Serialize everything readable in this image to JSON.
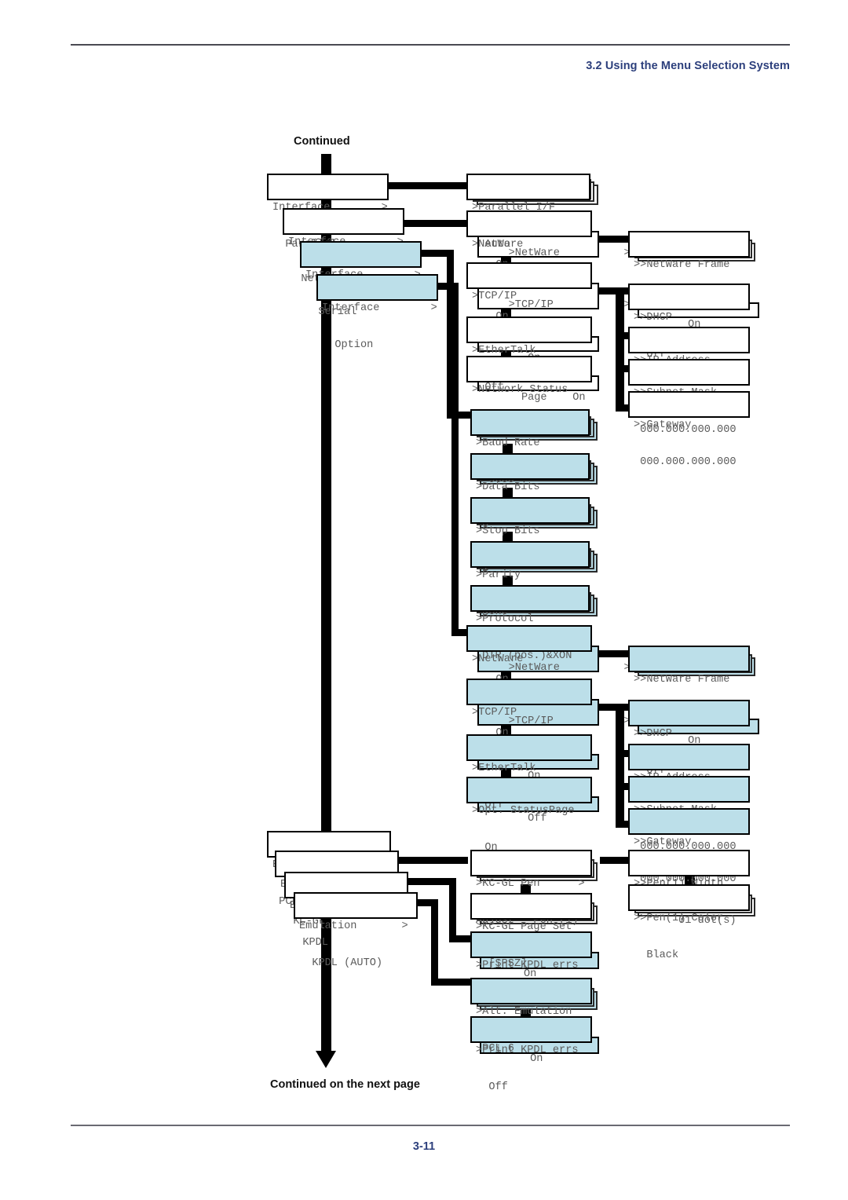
{
  "header": {
    "section_title": "3.2 Using the Menu Selection System"
  },
  "footer": {
    "page_number": "3-11"
  },
  "labels": {
    "continued_top": "Continued",
    "continued_bottom": "Continued on the next page"
  },
  "diagram": {
    "type": "printer-menu-tree",
    "spine_arrow": "down-arrow",
    "interface_column": [
      {
        "id": "iface-parallel",
        "line1": "Interface        >",
        "line2": "  Parallel",
        "highlight": false
      },
      {
        "id": "iface-network",
        "line1": "Interface        >",
        "line2": "  Network",
        "highlight": false
      },
      {
        "id": "iface-serial",
        "line1": "Interface        >",
        "line2": "  Serial",
        "highlight": true
      },
      {
        "id": "iface-option",
        "line1": "Interface        >",
        "line2": "  Option",
        "highlight": true
      }
    ],
    "emulation_column": [
      {
        "id": "emu-pcl6",
        "line1": "Emulation",
        "line2": " PCL 6",
        "highlight": false
      },
      {
        "id": "emu-kcgl",
        "line1": "Emulation       >",
        "line2": "  KC-GL",
        "highlight": false
      },
      {
        "id": "emu-kpdl",
        "line1": "Emulation       >",
        "line2": "  KPDL",
        "highlight": false
      },
      {
        "id": "emu-kpdl-auto",
        "line1": "Emulation       >",
        "line2": "  KPDL (AUTO)",
        "highlight": false
      }
    ],
    "parallel_branch": [
      {
        "id": "parallel-if",
        "line1": ">Parallel I/F",
        "line2": "  Auto",
        "highlight": false,
        "stacks": 3
      }
    ],
    "network_branch_1": [
      {
        "id": "net1-netware",
        "line1": ">NetWare",
        "line2": "  Off",
        "sub": ">NetWare          >\n  On",
        "highlight": false
      },
      {
        "id": "net1-tcpip",
        "line1": ">TCP/IP",
        "line2": "  Off",
        "sub": ">TCP/IP           >\n  On",
        "highlight": false
      },
      {
        "id": "net1-ethertalk",
        "line1": ">EtherTalk",
        "line2": "  Off",
        "sub": "   On",
        "highlight": false
      },
      {
        "id": "net1-netstatus",
        "line1": ">Network Status",
        "line2": " Page    Off",
        "sub": "  Page    On",
        "highlight": false
      }
    ],
    "network_branch_1_leaves": [
      {
        "id": "net1-netware-frame",
        "line1": ">>NetWare Frame",
        "line2": "  Auto",
        "highlight": false,
        "stacks": 3
      },
      {
        "id": "net1-dhcp",
        "line1": ">>DHCP",
        "line2": "  Off",
        "sub": "   On",
        "highlight": false
      },
      {
        "id": "net1-ip",
        "line1": ">>IP Address",
        "line2": " 000.000.000.000",
        "highlight": false
      },
      {
        "id": "net1-subnet",
        "line1": ">>Subnet Mask",
        "line2": " 000.000.000.000",
        "highlight": false
      },
      {
        "id": "net1-gateway",
        "line1": ">>Gateway",
        "line2": " 000.000.000.000",
        "highlight": false
      }
    ],
    "serial_branch": [
      {
        "id": "ser-baud",
        "line1": ">Baud Rate",
        "line2": "  9600",
        "highlight": true,
        "stacks": 3
      },
      {
        "id": "ser-databits",
        "line1": ">Data Bits",
        "line2": " 8",
        "highlight": true,
        "stacks": 3
      },
      {
        "id": "ser-stopbits",
        "line1": ">Stop Bits",
        "line2": " 1",
        "highlight": true,
        "stacks": 3
      },
      {
        "id": "ser-parity",
        "line1": ">Parity",
        "line2": " None",
        "highlight": true,
        "stacks": 3
      },
      {
        "id": "ser-protocol",
        "line1": ">Protocol",
        "line2": " DTR (pos.)&XON",
        "highlight": true,
        "stacks": 3
      }
    ],
    "network_branch_2": [
      {
        "id": "net2-netware",
        "line1": ">NetWare",
        "line2": "  Off",
        "sub": ">NetWare          >\n  On",
        "highlight": true
      },
      {
        "id": "net2-tcpip",
        "line1": ">TCP/IP",
        "line2": "  Off",
        "sub": ">TCP/IP           >\n  On",
        "highlight": true
      },
      {
        "id": "net2-ethertalk",
        "line1": ">EtherTalk",
        "line2": "  Off",
        "sub": "   On",
        "highlight": true
      },
      {
        "id": "net2-optstatus",
        "line1": ">Opt. StatusPage",
        "line2": "  On",
        "sub": "   Off",
        "highlight": true
      }
    ],
    "network_branch_2_leaves": [
      {
        "id": "net2-netware-frame",
        "line1": ">>NetWare Frame",
        "line2": "  Auto",
        "highlight": true,
        "stacks": 3
      },
      {
        "id": "net2-dhcp",
        "line1": ">>DHCP",
        "line2": "  Off",
        "sub": "   On",
        "highlight": true
      },
      {
        "id": "net2-ip",
        "line1": ">>IP Address",
        "line2": " 000.000.000.000",
        "highlight": true
      },
      {
        "id": "net2-subnet",
        "line1": ">>Subnet Mask",
        "line2": " 000.000.000.000",
        "highlight": true
      },
      {
        "id": "net2-gateway",
        "line1": ">>Gateway",
        "line2": " 000.000.000.000",
        "highlight": true
      }
    ],
    "emulation_branch": [
      {
        "id": "emu-kcgl-pen",
        "line1": ">KC-GL Pen      >",
        "line2": "Adjust   Pen (1)",
        "highlight": false,
        "stacks": 3
      },
      {
        "id": "emu-kcgl-pageset",
        "line1": ">KC-GL Page Set",
        "line2": "  [SPSZ]",
        "highlight": false,
        "stacks": 3
      },
      {
        "id": "emu-print-kpdl-1",
        "line1": ">Print KPDL errs",
        "line2": " Off",
        "sub": "  On",
        "highlight": true
      },
      {
        "id": "emu-alt-emulation",
        "line1": ">Alt. Emulation",
        "line2": " PCL 6",
        "highlight": true,
        "stacks": 3
      },
      {
        "id": "emu-print-kpdl-2",
        "line1": ">Print KPDL errs",
        "line2": "  Off",
        "sub": "   On",
        "highlight": true
      }
    ],
    "pen_leaves": [
      {
        "id": "pen1-width",
        "line1": ">>Pen(1) Width",
        "line2": "       01 dot(s)",
        "highlight": false
      },
      {
        "id": "pen1-color",
        "line1": ">>Pen(1) Color",
        "line2": "  Black",
        "highlight": false,
        "stacks": 3
      }
    ]
  }
}
